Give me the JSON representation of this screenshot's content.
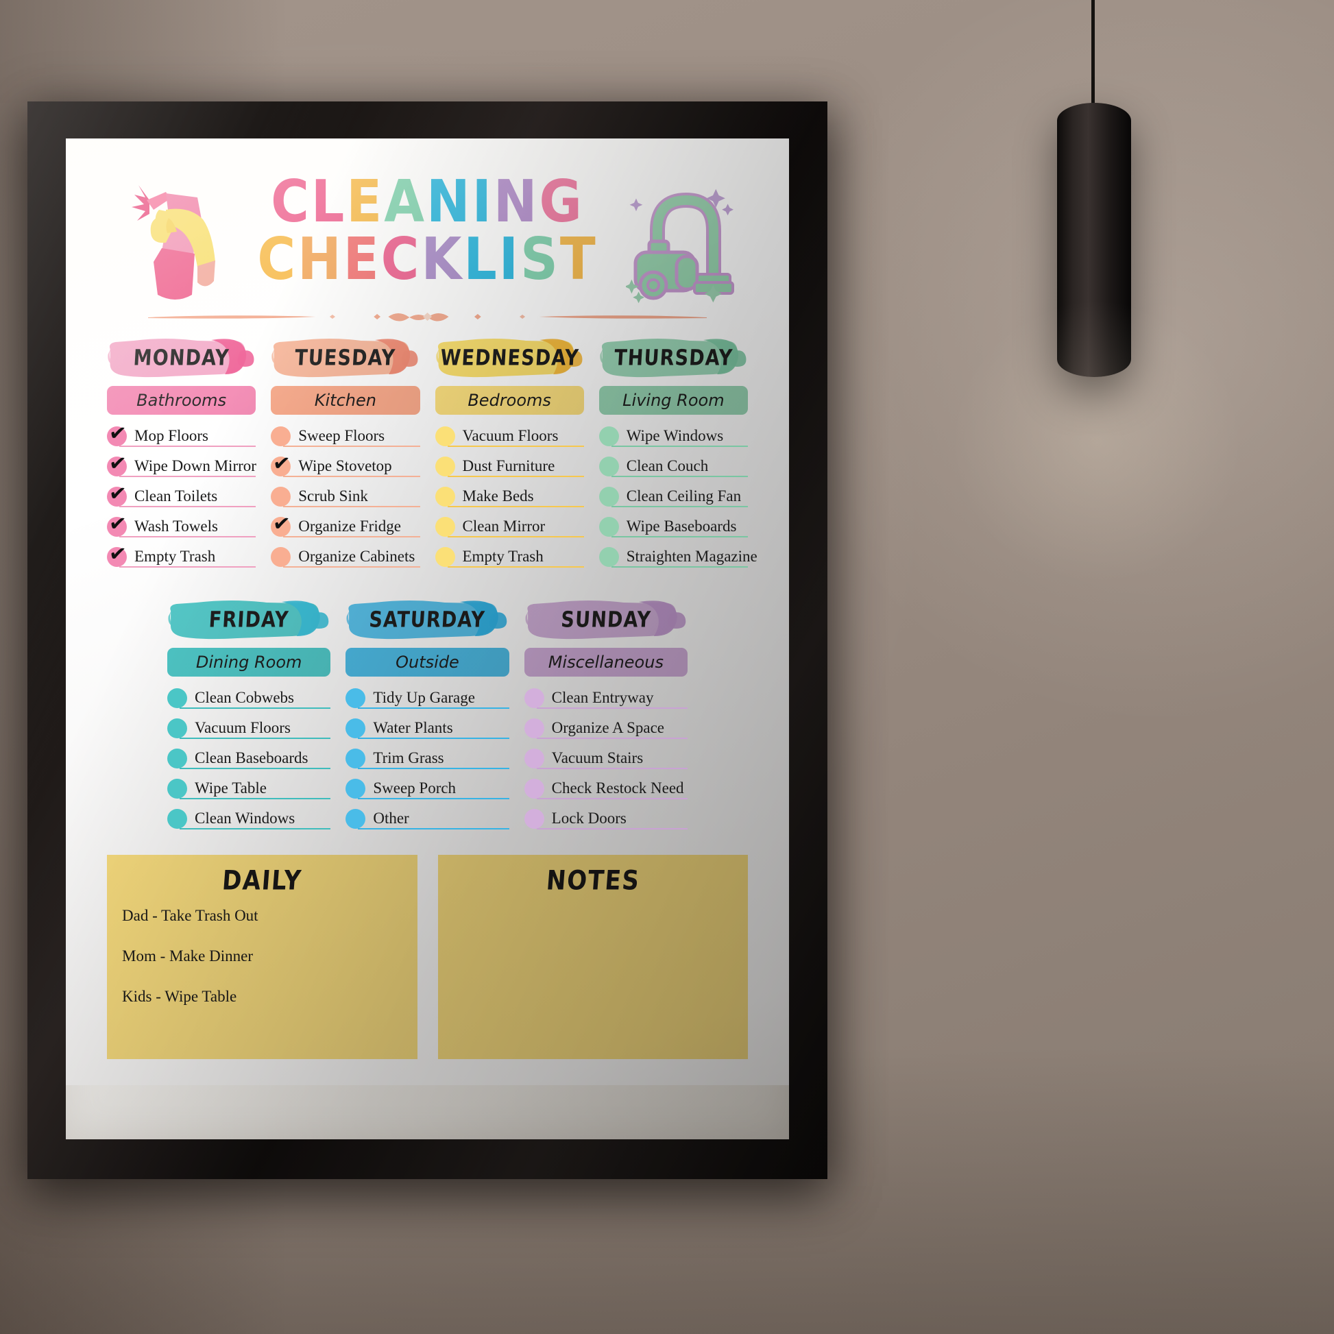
{
  "poster": {
    "title_lines": [
      {
        "letters": [
          {
            "ch": "C",
            "color": "#ED5F8E"
          },
          {
            "ch": "L",
            "color": "#ED5F8E"
          },
          {
            "ch": "E",
            "color": "#F7B948"
          },
          {
            "ch": "A",
            "color": "#7ED2AE"
          },
          {
            "ch": "N",
            "color": "#27B7E0"
          },
          {
            "ch": "I",
            "color": "#27B7E0"
          },
          {
            "ch": "N",
            "color": "#B08ACB"
          },
          {
            "ch": "G",
            "color": "#F0739E"
          }
        ]
      },
      {
        "letters": [
          {
            "ch": "C",
            "color": "#F7B948"
          },
          {
            "ch": "H",
            "color": "#F2A65A"
          },
          {
            "ch": "E",
            "color": "#F27272"
          },
          {
            "ch": "C",
            "color": "#ED5F8E"
          },
          {
            "ch": "K",
            "color": "#A98BC9"
          },
          {
            "ch": "L",
            "color": "#27B7E0"
          },
          {
            "ch": "I",
            "color": "#27B7E0"
          },
          {
            "ch": "S",
            "color": "#7ED2AE"
          },
          {
            "ch": "T",
            "color": "#F7B948"
          }
        ]
      }
    ],
    "title_text": "CLEANING CHECKLIST",
    "spray_icon": "spray-bottle-icon",
    "vacuum_icon": "vacuum-cleaner-icon"
  },
  "days": [
    {
      "name": "MONDAY",
      "room": "Bathrooms",
      "brush_light": "#F3A9C8",
      "brush_dark": "#EE5C93",
      "banner": "#F389B3",
      "bullet": "#F389B3",
      "rule": "#F0A0C0",
      "tasks": [
        {
          "label": "Mop Floors",
          "checked": true
        },
        {
          "label": "Wipe Down Mirror",
          "checked": true
        },
        {
          "label": "Clean Toilets",
          "checked": true
        },
        {
          "label": "Wash Towels",
          "checked": true
        },
        {
          "label": "Empty Trash",
          "checked": true
        }
      ]
    },
    {
      "name": "TUESDAY",
      "room": "Kitchen",
      "brush_light": "#F8B79B",
      "brush_dark": "#F08871",
      "banner": "#F8A98A",
      "bullet": "#F9AE92",
      "rule": "#F4B095",
      "tasks": [
        {
          "label": "Sweep Floors",
          "checked": false
        },
        {
          "label": "Wipe Stovetop",
          "checked": true
        },
        {
          "label": "Scrub Sink",
          "checked": false
        },
        {
          "label": "Organize Fridge",
          "checked": true
        },
        {
          "label": "Organize Cabinets",
          "checked": false
        }
      ]
    },
    {
      "name": "WEDNESDAY",
      "room": "Bedrooms",
      "brush_light": "#FBE06E",
      "brush_dark": "#F6B93B",
      "banner": "#FCE07F",
      "bullet": "#FBE077",
      "rule": "#F6C84E",
      "tasks": [
        {
          "label": "Vacuum Floors",
          "checked": false
        },
        {
          "label": "Dust Furniture",
          "checked": false
        },
        {
          "label": "Make Beds",
          "checked": false
        },
        {
          "label": "Clean Mirror",
          "checked": false
        },
        {
          "label": "Empty Trash",
          "checked": false
        }
      ]
    },
    {
      "name": "THURSDAY",
      "room": "Living Room",
      "brush_light": "#9BD6B7",
      "brush_dark": "#7DC9A4",
      "banner": "#96D3B2",
      "bullet": "#93D0AF",
      "rule": "#79C6A2",
      "tasks": [
        {
          "label": "Wipe Windows",
          "checked": false
        },
        {
          "label": "Clean Couch",
          "checked": false
        },
        {
          "label": "Clean Ceiling Fan",
          "checked": false
        },
        {
          "label": "Wipe Baseboards",
          "checked": false
        },
        {
          "label": "Straighten Magazine",
          "checked": false
        }
      ]
    },
    {
      "name": "FRIDAY",
      "room": "Dining Room",
      "brush_light": "#55CBCB",
      "brush_dark": "#3BC2DC",
      "banner": "#4EC8C8",
      "bullet": "#4BC6C6",
      "rule": "#3FBCBC",
      "tasks": [
        {
          "label": "Clean Cobwebs",
          "checked": false
        },
        {
          "label": "Vacuum Floors",
          "checked": false
        },
        {
          "label": "Clean Baseboards",
          "checked": false
        },
        {
          "label": "Wipe Table",
          "checked": false
        },
        {
          "label": "Clean Windows",
          "checked": false
        }
      ]
    },
    {
      "name": "SATURDAY",
      "room": "Outside",
      "brush_light": "#58C2EC",
      "brush_dark": "#2FB4E8",
      "banner": "#4CBDE8",
      "bullet": "#4ABCE8",
      "rule": "#36B3E4",
      "tasks": [
        {
          "label": "Tidy Up Garage",
          "checked": false
        },
        {
          "label": "Water Plants",
          "checked": false
        },
        {
          "label": "Trim Grass",
          "checked": false
        },
        {
          "label": "Sweep Porch",
          "checked": false
        },
        {
          "label": "Other",
          "checked": false
        }
      ]
    },
    {
      "name": "SUNDAY",
      "room": "Miscellaneous",
      "brush_light": "#D3B1DC",
      "brush_dark": "#C59CD4",
      "banner": "#D2AEDC",
      "bullet": "#D3AFDC",
      "rule": "#C9A2D4",
      "tasks": [
        {
          "label": "Clean Entryway",
          "checked": false
        },
        {
          "label": "Organize A Space",
          "checked": false
        },
        {
          "label": "Vacuum Stairs",
          "checked": false
        },
        {
          "label": "Check Restock Need",
          "checked": false
        },
        {
          "label": "Lock Doors",
          "checked": false
        }
      ]
    }
  ],
  "bottom": {
    "daily": {
      "title": "DAILY",
      "lines": [
        "Dad - Take Trash Out",
        "Mom - Make Dinner",
        "Kids - Wipe Table"
      ]
    },
    "notes": {
      "title": "NOTES",
      "lines": []
    }
  }
}
